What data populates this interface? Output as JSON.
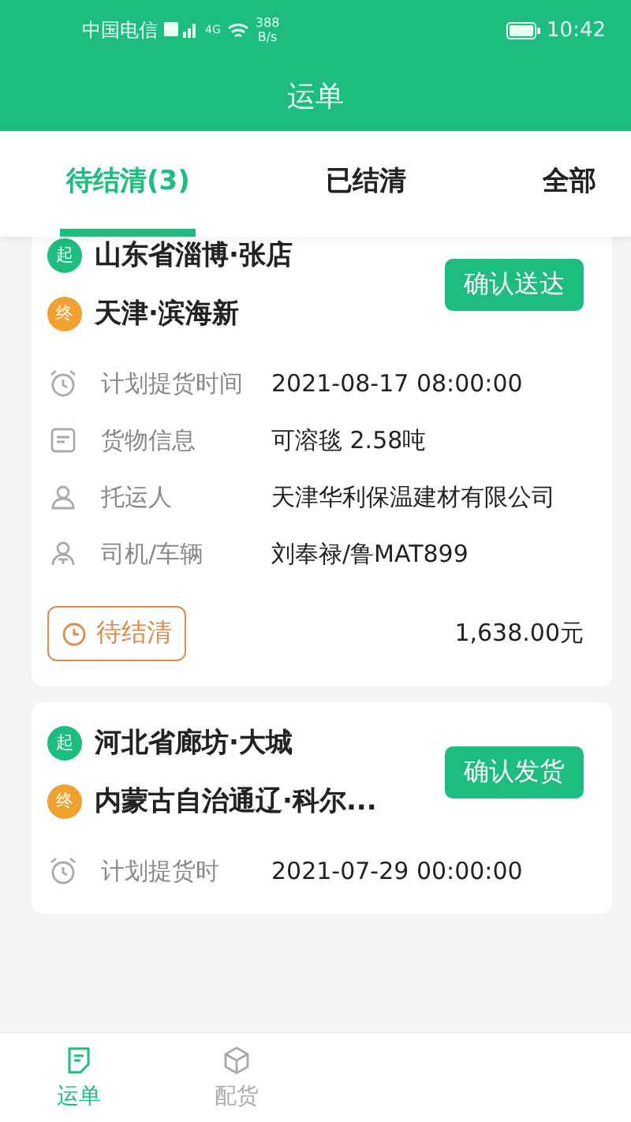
{
  "status_bar": {
    "carrier": "中国电信",
    "network": "4G",
    "speed": "388",
    "speed_unit": "B/s",
    "time": "10:42"
  },
  "header": {
    "title": "运单"
  },
  "tabs": [
    {
      "label": "待结清(3)",
      "selected": true
    },
    {
      "label": "已结清",
      "selected": false
    },
    {
      "label": "全部",
      "selected": false
    }
  ],
  "orders": [
    {
      "origin_badge": "起",
      "origin": "山东省淄博·张店",
      "destination_badge": "终",
      "destination": "天津·滨海新",
      "action": "确认送达",
      "fields": [
        {
          "kind": "clock",
          "label": "计划提货时间",
          "value": "2021-08-17 08:00:00"
        },
        {
          "kind": "goods",
          "label": "货物信息",
          "value": "可溶毯 2.58吨"
        },
        {
          "kind": "shipper",
          "label": "托运人",
          "value": "天津华利保温建材有限公司"
        },
        {
          "kind": "driver",
          "label": "司机/车辆",
          "value": "刘奉禄/鲁MAT899"
        }
      ],
      "status": "待结清",
      "amount": "1,638.00元"
    },
    {
      "origin_badge": "起",
      "origin": "河北省廊坊·大城",
      "destination_badge": "终",
      "destination": "内蒙古自治通辽·科尔...",
      "action": "确认发货",
      "fields": [
        {
          "kind": "clock",
          "label": "计划提货时",
          "value": "2021-07-29 00:00:00"
        }
      ]
    }
  ],
  "bottom_nav": [
    {
      "kind": "waybill",
      "label": "运单",
      "selected": true
    },
    {
      "kind": "box",
      "label": "配货",
      "selected": false
    }
  ]
}
